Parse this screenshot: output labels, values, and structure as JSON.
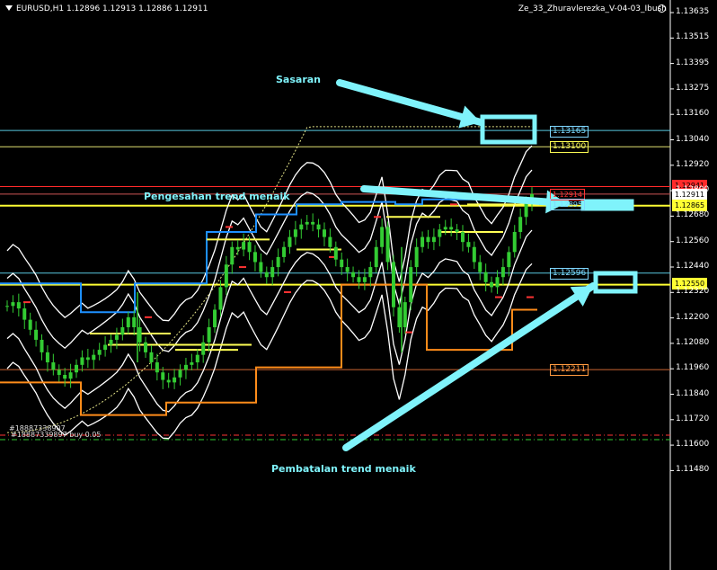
{
  "header": {
    "symbol_info": "EURUSD,H1  1.12896 1.12913 1.12886 1.12911",
    "indicator_name": "Ze_33_Zhuravlerezka_V-04-03_Ibush"
  },
  "annotations": {
    "target": "Sasaran",
    "confirm": "Pengesahan trend menaik",
    "cancel": "Pembatalan trend menaik"
  },
  "price_axis": {
    "ticks": [
      "1.13635",
      "1.13515",
      "1.13395",
      "1.13275",
      "1.13160",
      "1.13040",
      "1.12920",
      "1.12800",
      "1.12680",
      "1.12560",
      "1.12440",
      "1.12320",
      "1.12200",
      "1.12080",
      "1.11960",
      "1.11840",
      "1.11720",
      "1.11600",
      "1.11480"
    ]
  },
  "level_labels": {
    "l13165": "1.13165",
    "l13100": "1.13100",
    "l12941": "1.12941",
    "l12911": "1.12911",
    "l12865": "1.12865",
    "l12596": "1.12596",
    "l12550": "1.12550",
    "l12211": "1.12211",
    "l12914": "1.12914",
    "l12895": "1.12895"
  },
  "order_labels": {
    "top": "#18887338907",
    "bottom": "#18887339897 buy 0.05"
  },
  "colors": {
    "background": "#000000",
    "candles": "#33cc33",
    "bands": "#ffffff",
    "annotation": "#7FF3FB",
    "support": "#ffff55",
    "trail_blue": "#1e90ff",
    "trail_orange": "#ff8c1a"
  }
}
